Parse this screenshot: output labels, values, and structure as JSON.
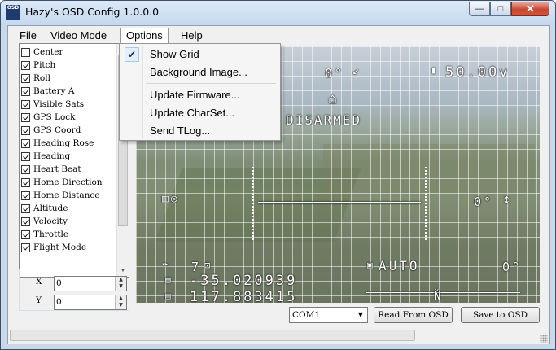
{
  "window": {
    "title": "Hazy's OSD Config 1.0.0.0",
    "icon_text": "OSD",
    "controls": {
      "minimize": "—",
      "maximize": "□",
      "close": "✕"
    }
  },
  "menubar": {
    "items": [
      "File",
      "Video Mode",
      "Options",
      "Help"
    ]
  },
  "options_menu": {
    "items": [
      {
        "label": "Show Grid",
        "checked": true
      },
      {
        "label": "Background Image...",
        "checked": false
      },
      {
        "label": "Update Firmware...",
        "checked": false
      },
      {
        "label": "Update CharSet...",
        "checked": false
      },
      {
        "label": "Send TLog...",
        "checked": false
      }
    ],
    "check_glyph": "✔"
  },
  "panel_list": {
    "items": [
      {
        "label": "Center",
        "checked": false
      },
      {
        "label": "Pitch",
        "checked": true
      },
      {
        "label": "Roll",
        "checked": true
      },
      {
        "label": "Battery A",
        "checked": true
      },
      {
        "label": "Visible Sats",
        "checked": true
      },
      {
        "label": "GPS Lock",
        "checked": true
      },
      {
        "label": "GPS Coord",
        "checked": true
      },
      {
        "label": "Heading Rose",
        "checked": true
      },
      {
        "label": "Heading",
        "checked": true
      },
      {
        "label": "Heart Beat",
        "checked": true
      },
      {
        "label": "Home Direction",
        "checked": true
      },
      {
        "label": "Home Distance",
        "checked": true
      },
      {
        "label": "Altitude",
        "checked": true
      },
      {
        "label": "Velocity",
        "checked": true
      },
      {
        "label": "Throttle",
        "checked": true
      },
      {
        "label": "Flight Mode",
        "checked": true
      }
    ]
  },
  "position": {
    "x_label": "X",
    "x_value": "0",
    "y_label": "Y",
    "y_value": "0"
  },
  "osd": {
    "pitch": "0°",
    "battery": "50.00v",
    "status": "DISARMED",
    "roll": "0°",
    "sats": "7",
    "lat": "-35.020939",
    "lon": "117.883415",
    "mode": "AUTO",
    "heading": "0°",
    "rose_letter": "N"
  },
  "bottom": {
    "com_port": "COM1",
    "read_button": "Read From OSD",
    "save_button": "Save to OSD"
  }
}
